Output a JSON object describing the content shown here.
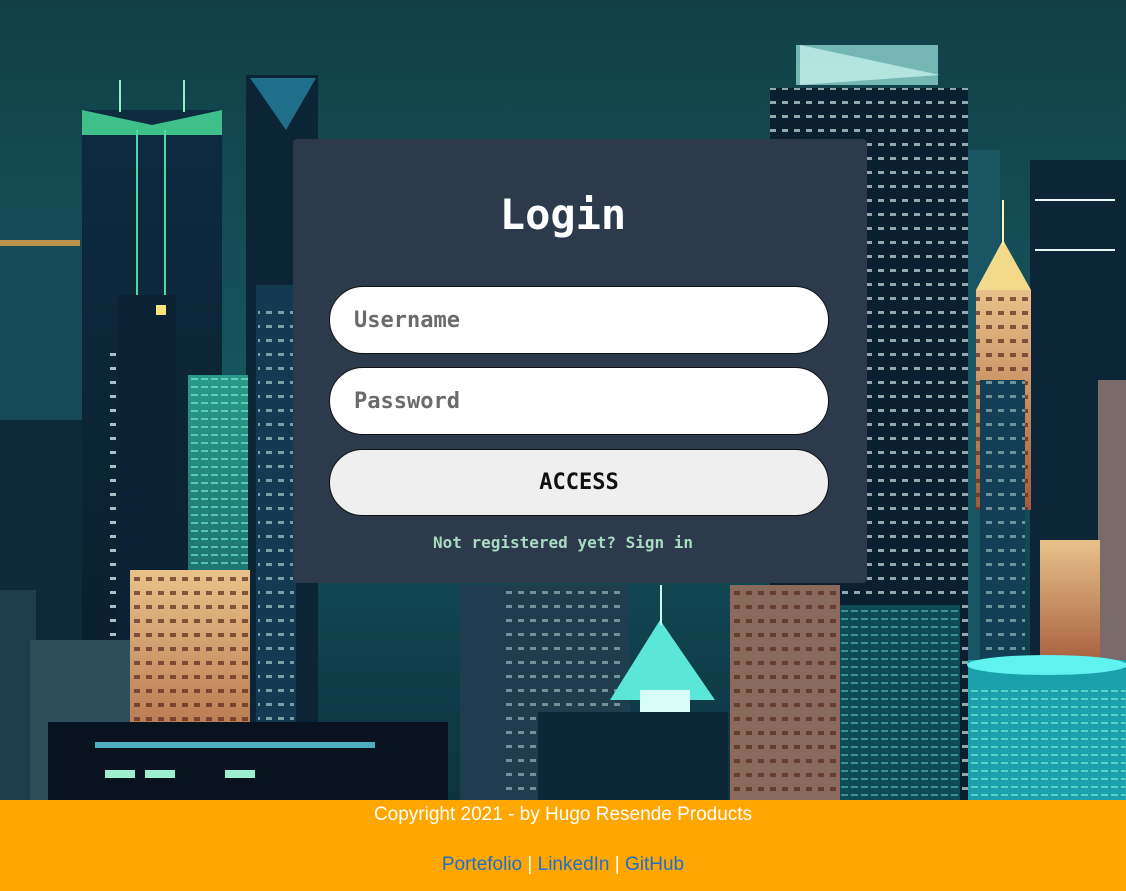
{
  "login": {
    "title": "Login",
    "username_placeholder": "Username",
    "password_placeholder": "Password",
    "access_label": "ACCESS",
    "signup_text": "Not registered yet? Sign in"
  },
  "footer": {
    "copyright": "Copyright 2021 - by Hugo Resende Products",
    "links": [
      "Portefolio",
      "LinkedIn",
      "GitHub"
    ],
    "separator": "|"
  },
  "colors": {
    "card_background": "#2c3a4b",
    "footer_background": "#ffa600",
    "link": "#1a6fd0",
    "signup_text": "#a8dcc0"
  },
  "icons": {
    "background": "city-skyline-illustration"
  }
}
